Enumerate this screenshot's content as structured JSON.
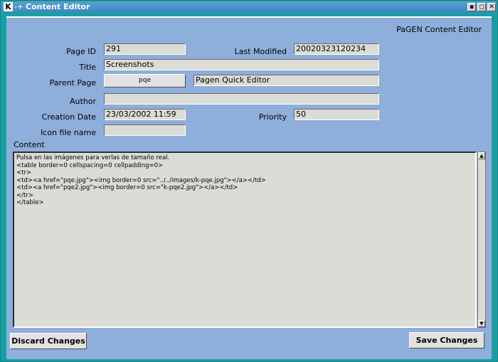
{
  "window": {
    "title": "Content Editor",
    "app_icon": "K",
    "pin_glyph": "-+",
    "controls": {
      "minimize": "▪",
      "maximize": "◻",
      "close": "✕"
    }
  },
  "header": {
    "app_name": "PaGEN Content Editor"
  },
  "form": {
    "page_id": {
      "label": "Page ID",
      "value": "291"
    },
    "last_modified": {
      "label": "Last Modified",
      "value": "20020323120234"
    },
    "title": {
      "label": "Title",
      "value": "Screenshots"
    },
    "parent_page": {
      "label": "Parent Page",
      "button": "pqe",
      "value": "Pagen Quick Editor"
    },
    "author": {
      "label": "Author",
      "value": ""
    },
    "creation_date": {
      "label": "Creation Date",
      "value": "23/03/2002 11:59"
    },
    "priority": {
      "label": "Priority",
      "value": "50"
    },
    "icon_file": {
      "label": "Icon file name",
      "value": ""
    },
    "content": {
      "label": "Content",
      "value": "Pulsa en las imágenes para verlas de tamaño real.\n<table border=0 cellspacing=0 cellpadding=0>\n<tr>\n<td><a href=\"pqe.jpg\"><img border=0 src=\"../../images/k-pqe.jpg\"></a></td>\n<td><a href=\"pqe2.jpg\"><img border=0 src=\"k-pqe2.jpg\"></a></td>\n</tr>\n</table>"
    }
  },
  "actions": {
    "discard": "Discard Changes",
    "save": "Save Changes"
  },
  "scrollbar": {
    "up": "▲",
    "down": "▼"
  }
}
